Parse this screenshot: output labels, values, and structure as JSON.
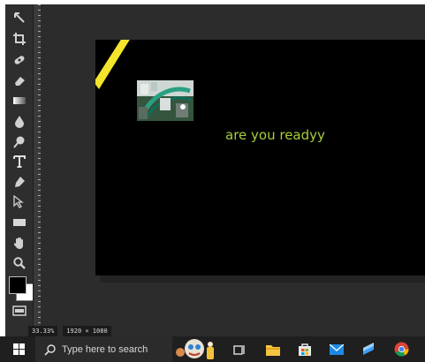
{
  "app": {
    "tools": [
      "move-tool",
      "crop-tool",
      "healing-tool",
      "eraser-tool",
      "gradient-tool",
      "blur-tool",
      "dodge-tool",
      "type-tool",
      "pen-tool",
      "path-select-tool",
      "rectangle-tool",
      "hand-tool",
      "zoom-tool"
    ],
    "foreground_color": "#000000",
    "background_color": "#ffffff"
  },
  "canvas": {
    "text_layer": "are you readyy",
    "text_color": "#a8cd38",
    "stroke_color": "#f3e52b",
    "background": "#000000"
  },
  "status": {
    "zoom": "33.33%",
    "dimensions": "1920 × 1080"
  },
  "taskbar": {
    "search_placeholder": "Type here to search",
    "accent": "#1e88e5"
  }
}
